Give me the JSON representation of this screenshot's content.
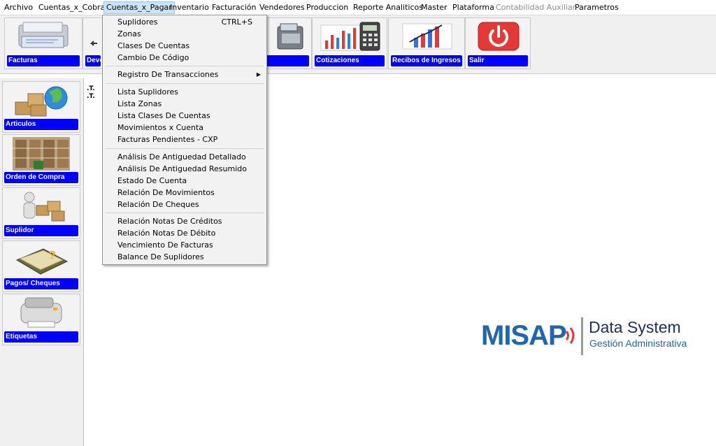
{
  "menubar": {
    "items": [
      {
        "label": "Archivo"
      },
      {
        "label": "Cuentas_x_Cobrar"
      },
      {
        "label": "Cuentas_x_Pagar",
        "state": "open"
      },
      {
        "label": "Inventario"
      },
      {
        "label": "Facturación"
      },
      {
        "label": "Vendedores"
      },
      {
        "label": "Produccion"
      },
      {
        "label": "Reporte Analiticos"
      },
      {
        "label": "Master"
      },
      {
        "label": "Plataforma"
      },
      {
        "label": "Contabilidad Auxiliar",
        "state": "disabled"
      },
      {
        "label": "Parametros"
      }
    ]
  },
  "toolbar": {
    "buttons": [
      {
        "label": "Facturas",
        "icon": "invoice-printer-icon"
      },
      {
        "label": "Devo",
        "icon": "return-icon"
      },
      {
        "label": "",
        "icon": "cash-register-icon"
      },
      {
        "label": "Cotizaciones",
        "icon": "chart-calculator-icon"
      },
      {
        "label": "Recibos de Ingresos",
        "icon": "income-receipt-icon"
      },
      {
        "label": "Salir",
        "icon": "power-icon"
      }
    ]
  },
  "sidebar": {
    "buttons": [
      {
        "label": "Articulos",
        "icon": "globe-boxes-icon"
      },
      {
        "label": "Orden de Compra",
        "icon": "warehouse-icon"
      },
      {
        "label": "Suplidor",
        "icon": "supplier-boxes-icon"
      },
      {
        "label": "Pagos/ Cheques",
        "icon": "checkbook-icon"
      },
      {
        "label": "Etiquetas",
        "icon": "label-printer-icon"
      }
    ]
  },
  "stub_text": {
    "line1": ".T.",
    "line2": ".T."
  },
  "dropdown": {
    "groups": [
      [
        {
          "label": "Suplidores",
          "shortcut": "CTRL+S"
        },
        {
          "label": "Zonas"
        },
        {
          "label": "Clases De Cuentas"
        },
        {
          "label": "Cambio De Código"
        }
      ],
      [
        {
          "label": "Registro De Transacciones",
          "submenu": true
        }
      ],
      [
        {
          "label": "Lista Suplidores"
        },
        {
          "label": "Lista Zonas"
        },
        {
          "label": "Lista  Clases De Cuentas"
        },
        {
          "label": "Movimientos x Cuenta"
        },
        {
          "label": "Facturas Pendientes - CXP"
        }
      ],
      [
        {
          "label": "Análisis De Antiguedad Detallado"
        },
        {
          "label": "Análisis De Antiguedad  Resumido"
        },
        {
          "label": "Estado De Cuenta"
        },
        {
          "label": "Relación De Movimientos"
        },
        {
          "label": "Relación De Cheques"
        }
      ],
      [
        {
          "label": "Relación Notas De Créditos"
        },
        {
          "label": "Relación Notas De Débito"
        },
        {
          "label": "Vencimiento De Facturas"
        },
        {
          "label": "Balance De Suplidores"
        }
      ]
    ]
  },
  "logo": {
    "brand": "MISAP",
    "product": "Data System",
    "tagline": "Gestión Administrativa",
    "colors": {
      "brand": "#1f67ad",
      "waves": "#e53935",
      "product": "#1e2f64"
    }
  }
}
